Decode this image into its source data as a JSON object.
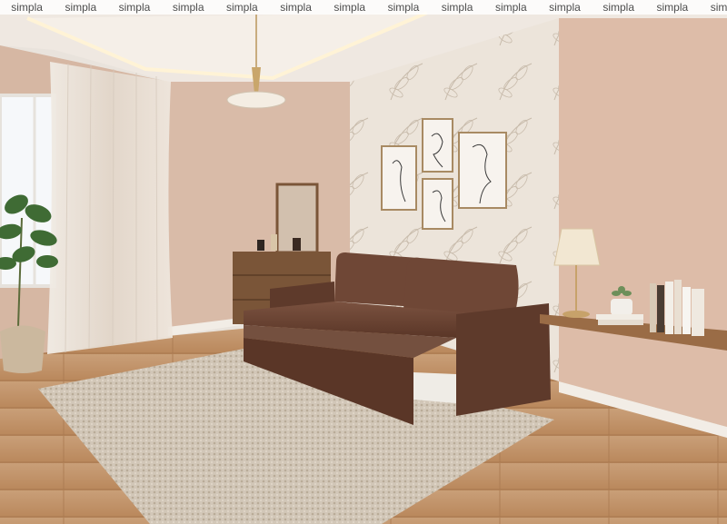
{
  "watermark": {
    "text": "simpla",
    "repeats": [
      "simpla",
      "simpla",
      "simpla",
      "simpla",
      "simpla",
      "simpla",
      "simpla",
      "simpla",
      "simpla",
      "simpla",
      "simpla",
      "simpla",
      "simpla",
      "simpla"
    ]
  },
  "scene": {
    "subject": "living room interior with brown sofa bed",
    "colors": {
      "wall": "#d8b8a4",
      "ceiling": "#efe8e1",
      "floor": "#c4956a",
      "sofa": "#6a4331",
      "rug": "#cfc4b5",
      "accent_wallpaper": "#ece4da",
      "dresser": "#7a5538"
    }
  }
}
